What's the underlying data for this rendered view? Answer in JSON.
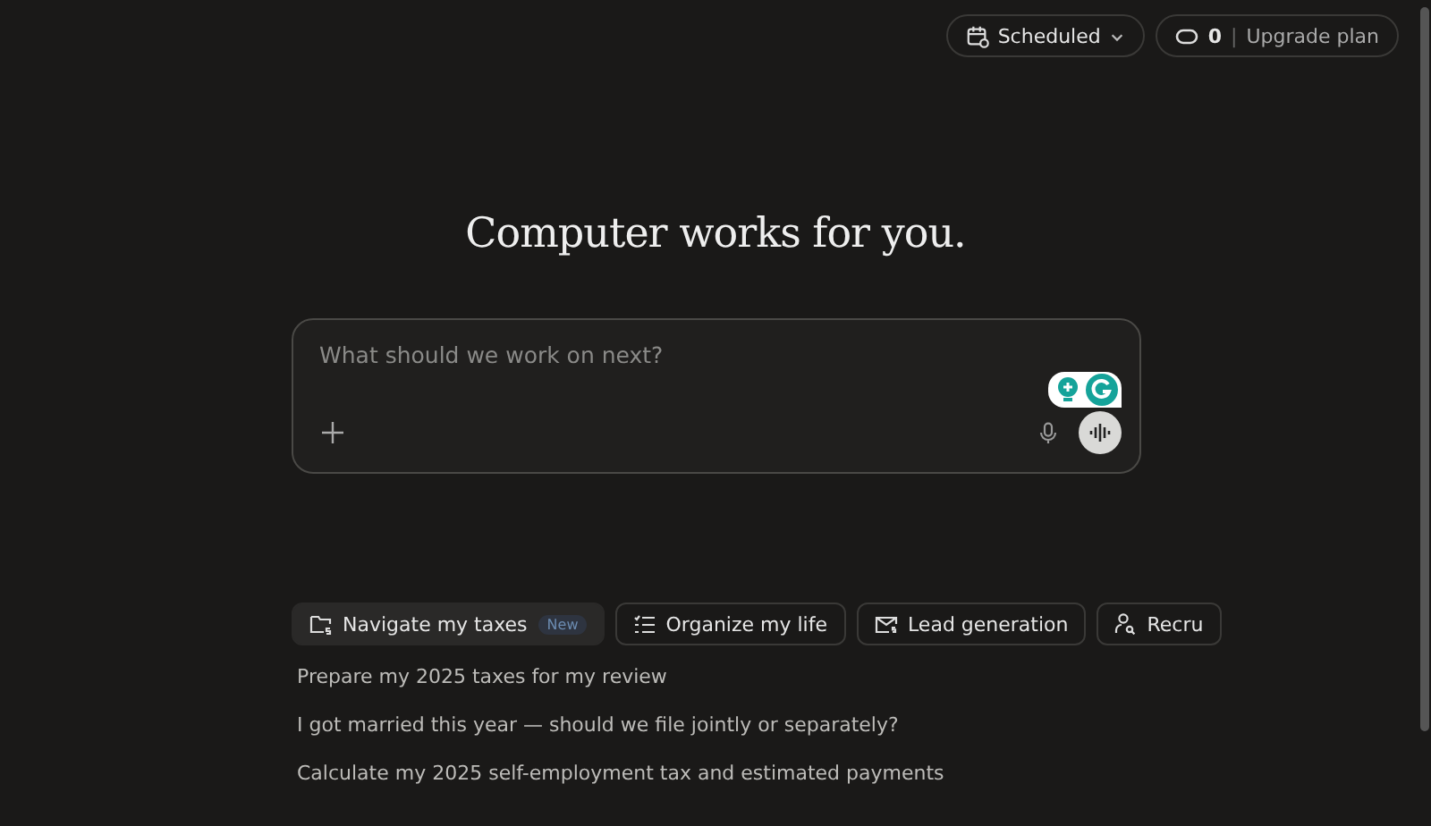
{
  "header": {
    "scheduled_button": "Scheduled",
    "credits": "0",
    "separator": "|",
    "upgrade_link": "Upgrade plan"
  },
  "headline": "Computer works for you.",
  "composer": {
    "placeholder": "What should we work on next?"
  },
  "chips": [
    {
      "label": "Navigate my taxes",
      "badge": "New",
      "selected": true,
      "kind": "folder"
    },
    {
      "label": "Organize my life",
      "selected": false,
      "kind": "list"
    },
    {
      "label": "Lead generation",
      "selected": false,
      "kind": "mail"
    },
    {
      "label": "Recru",
      "selected": false,
      "kind": "person"
    }
  ],
  "suggestions": [
    "Prepare my 2025 taxes for my review",
    "I got married this year — should we file jointly or separately?",
    "Calculate my 2025 self-employment tax and estimated payments"
  ]
}
